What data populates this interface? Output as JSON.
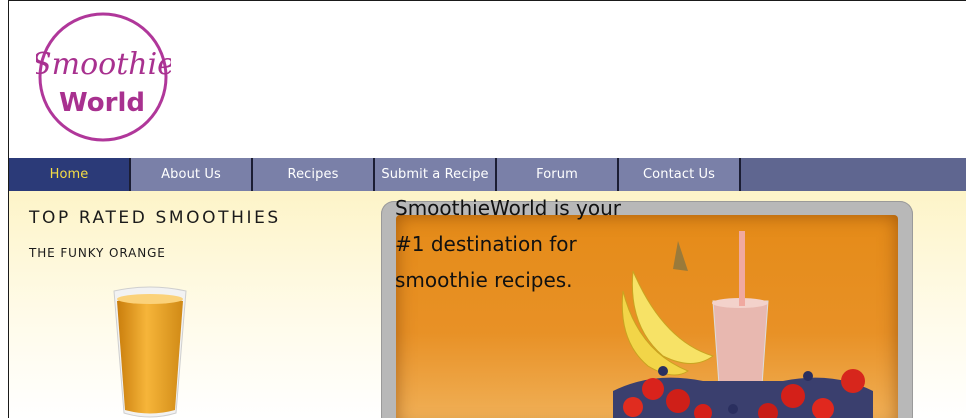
{
  "logo": {
    "line1": "Smoothie",
    "line2": "World",
    "ring_color": "#b0379a"
  },
  "nav": {
    "items": [
      {
        "label": "Home",
        "active": true
      },
      {
        "label": "About Us"
      },
      {
        "label": "Recipes"
      },
      {
        "label": "Submit a Recipe"
      },
      {
        "label": "Forum"
      },
      {
        "label": "Contact Us"
      }
    ],
    "bar_color": "#5f6690",
    "active_color": "#2b3a78",
    "active_text_color": "#f5dd45"
  },
  "sidebar": {
    "heading": "TOP RATED SMOOTHIES",
    "featured_name": "THE FUNKY ORANGE",
    "featured_image_icon": "orange-smoothie-glass-icon"
  },
  "hero": {
    "line1": "SmoothieWorld is your",
    "line2": "#1 destination for",
    "line3": "smoothie recipes.",
    "image_icon": "smoothie-with-fruit-icon",
    "bg_color": "#e58b18"
  }
}
